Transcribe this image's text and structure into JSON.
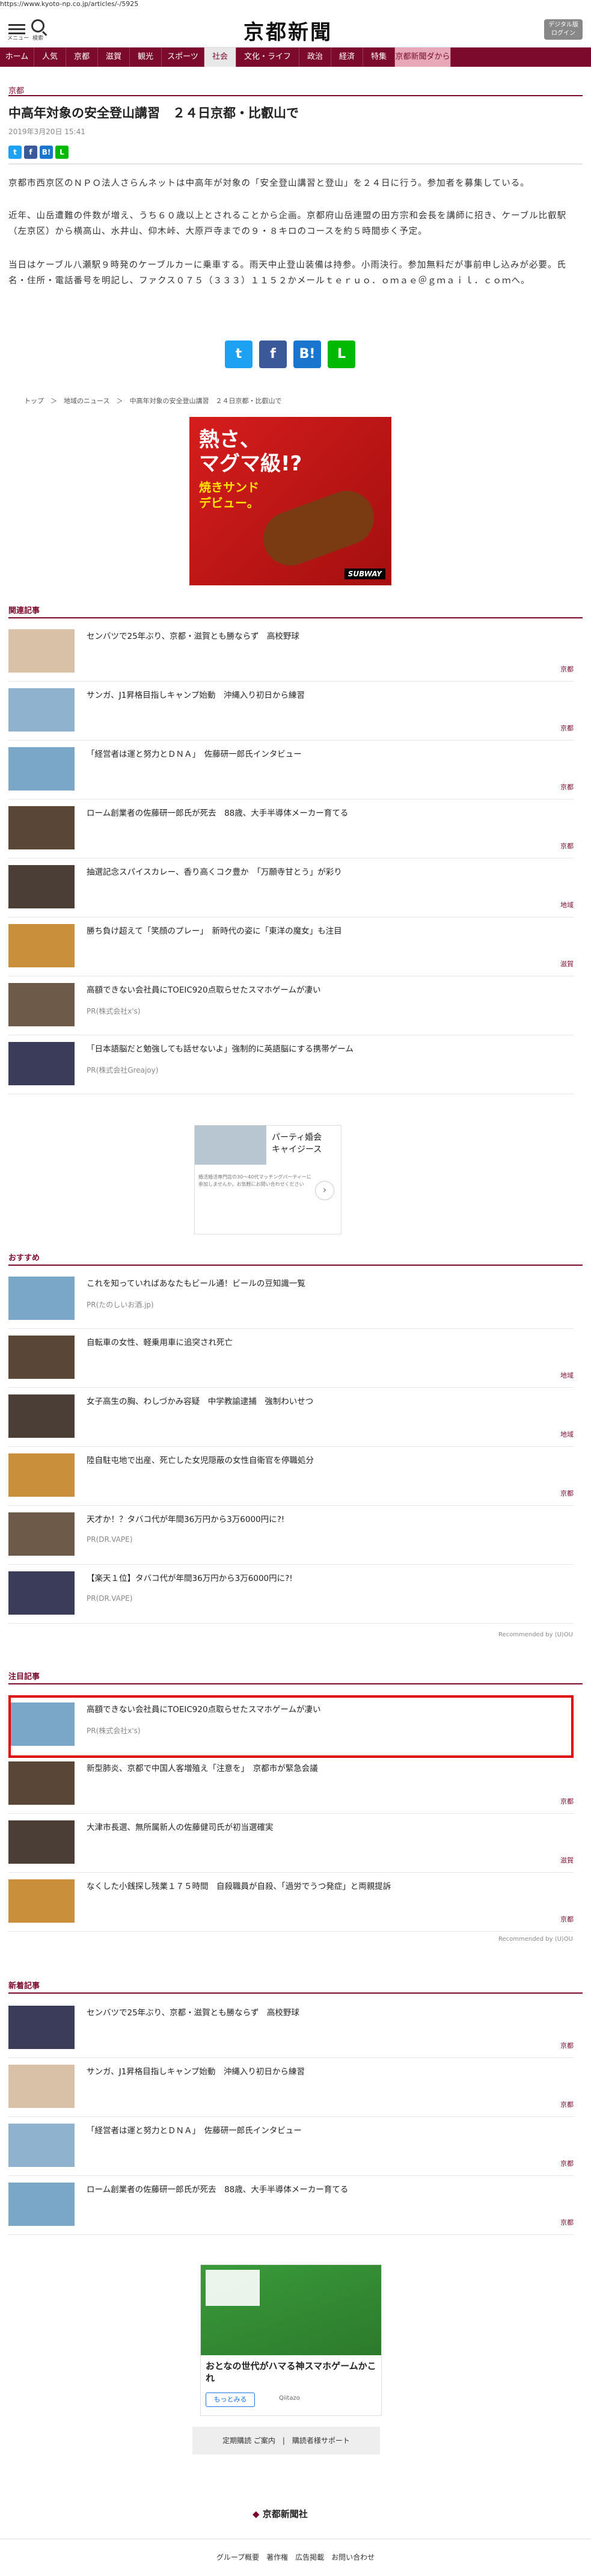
{
  "url": "https://www.kyoto-np.co.jp/articles/-/5925",
  "header": {
    "menu_label": "メニュー",
    "search_label": "検索",
    "logo": "京都新聞",
    "digital_btn": "デジタル版",
    "digital_btn2": "ログイン"
  },
  "nav": [
    "ホーム",
    "人気",
    "京都",
    "滋賀",
    "観光",
    "スポーツ",
    "社会",
    "文化・ライフ",
    "政治",
    "経済",
    "特集",
    "京都新聞ダから"
  ],
  "article": {
    "category": "京都",
    "title": "中高年対象の安全登山講習　２４日京都・比叡山で",
    "date": "2019年3月20日 15:41",
    "paragraphs": [
      "京都市西京区のＮＰＯ法人さらんネットは中高年が対象の「安全登山講習と登山」を２４日に行う。参加者を募集している。",
      "近年、山岳遭難の件数が増え、うち６０歳以上とされることから企画。京都府山岳連盟の田方宗和会長を講師に招き、ケーブル比叡駅（左京区）から横高山、水井山、仰木峠、大原戸寺までの９・８キロのコースを約５時間歩く予定。",
      "当日はケーブル八瀬駅９時発のケーブルカーに乗車する。雨天中止登山装備は持参。小雨決行。参加無料だが事前申し込みが必要。氏名・住所・電話番号を明記し、ファクス０７５（３３３）１１５２かメールｔｅｒｕｏ．ｏｍａｅ＠ｇｍａｉｌ．ｃｏｍへ。"
    ],
    "breadcrumb": "トップ　＞　地域のニュース　＞　中高年対象の安全登山講習　２４日京都・比叡山で"
  },
  "ad_burger": {
    "line1": "熱さ、",
    "line2": "マグマ級!?",
    "line3": "焼きサンド",
    "line4": "デビュー。",
    "brand": "SUBWAY"
  },
  "related": {
    "title": "関連記事",
    "items": [
      {
        "title": "センバツで25年ぶり、京都・滋賀とも勝ならず　高校野球",
        "tag": "京都"
      },
      {
        "title": "サンガ、J1昇格目指しキャンプ始動　沖縄入り初日から練習",
        "tag": "京都"
      },
      {
        "title": "「経営者は運と努力とＤＮＡ」　佐藤研一郎氏インタビュー",
        "tag": "京都"
      },
      {
        "title": "ローム創業者の佐藤研一郎氏が死去　88歳、大手半導体メーカー育てる",
        "tag": "京都"
      },
      {
        "title": "抽選記念スパイスカレー、香り高くコク豊か　「万願寺甘とう」が彩り",
        "tag": "地域"
      },
      {
        "title": "勝ち負け超えて「笑顔のプレー」　新時代の姿に「東洋の魔女」も注目",
        "tag": "滋賀"
      },
      {
        "title": "高額できない会社員にTOEIC920点取らせたスマホゲームが凄い",
        "pr": "PR(株式会社x's)"
      },
      {
        "title": "「日本語脳だと勉強しても話せないよ」強制的に英語脳にする携帯ゲーム",
        "pr": "PR(株式会社Greajoy)"
      }
    ]
  },
  "ad_party": {
    "title": "パーティ婚会",
    "title2": "キャイジース",
    "desc": "婚活婚活専門店の30〜40代マッチングパーティーに参加しませんか。お気軽にお問い合わせください"
  },
  "recommend": {
    "title": "おすすめ",
    "items": [
      {
        "title": "これを知っていればあなたもビール通！ビールの豆知識一覧",
        "pr": "PR(たのしいお酒.jp)"
      },
      {
        "title": "自転車の女性、軽乗用車に追突され死亡",
        "tag": "地域"
      },
      {
        "title": "女子高生の胸、わしづかみ容疑　中学教諭逮捕　強制わいせつ",
        "tag": "地域"
      },
      {
        "title": "陸自駐屯地で出産、死亡した女児隠蔽の女性自衛官を停職処分",
        "tag": "京都"
      },
      {
        "title": "天才か！？タバコ代が年間36万円から3万6000円に?!",
        "pr": "PR(DR.VAPE)"
      },
      {
        "title": "【楽天１位】タバコ代が年間36万円から3万6000円に?!",
        "pr": "PR(DR.VAPE)"
      }
    ],
    "recommended_by": "Recommended by ⟨U⟩OU"
  },
  "attention": {
    "title": "注目記事",
    "items": [
      {
        "title": "高額できない会社員にTOEIC920点取らせたスマホゲームが凄い",
        "pr": "PR(株式会社x's)"
      },
      {
        "title": "新型肺炎、京都で中国人客増殖え「注意を」　京都市が緊急会議",
        "tag": "京都"
      },
      {
        "title": "大津市長選、無所属新人の佐藤健司氏が初当選確実",
        "tag": "滋賀"
      },
      {
        "title": "なくした小銭探し残業１７５時間　自殺職員が自殺、「過労でうつ発症」と両親提訴",
        "tag": "京都"
      }
    ],
    "recommended_by": "Recommended by ⟨U⟩OU"
  },
  "latest": {
    "title": "新着記事",
    "items": [
      {
        "title": "センバツで25年ぶり、京都・滋賀とも勝ならず　高校野球",
        "tag": "京都"
      },
      {
        "title": "サンガ、J1昇格目指しキャンプ始動　沖縄入り初日から練習",
        "tag": "京都"
      },
      {
        "title": "「経営者は運と努力とＤＮＡ」　佐藤研一郎氏インタビュー",
        "tag": "京都"
      },
      {
        "title": "ローム創業者の佐藤研一郎氏が死去　88歳、大手半導体メーカー育てる",
        "tag": "京都"
      }
    ]
  },
  "ad_game": {
    "title": "おとなの世代がハマる神スマホゲームかこれ",
    "btn": "もっとみる",
    "adv": "Qiitazo"
  },
  "footer": {
    "links": "定期購読 ご案内　|　購読者様サポート",
    "logo": "京都新聞社",
    "nav": "グループ概要　著作権　広告掲載　お問い合わせ"
  },
  "colors": {
    "brand": "#7b0a2c"
  }
}
